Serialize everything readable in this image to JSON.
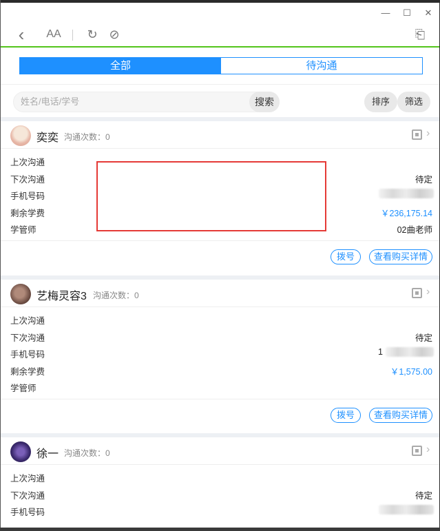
{
  "window": {
    "minimize": "—",
    "maximize": "☐",
    "close": "✕"
  },
  "toolbar": {
    "back_icon": "‹",
    "font_icon": "AA",
    "refresh_icon": "↻",
    "compass_icon": "⊘",
    "exit_icon": "⎗"
  },
  "tabs": [
    {
      "label": "全部",
      "active": true
    },
    {
      "label": "待沟通",
      "active": false
    }
  ],
  "search": {
    "placeholder": "姓名/电话/学号",
    "button": "搜索",
    "sort": "排序",
    "filter": "筛选"
  },
  "colors": {
    "accent": "#1e90ff",
    "progress": "#52c41a",
    "highlight_box": "#e53935"
  },
  "cards": [
    {
      "name": "奕奕",
      "count_label": "沟通次数：0",
      "rows": [
        {
          "label": "上次沟通",
          "value": ""
        },
        {
          "label": "下次沟通",
          "value": "待定"
        },
        {
          "label": "手机号码",
          "value": ""
        },
        {
          "label": "剩余学费",
          "value": "￥236,175.14"
        },
        {
          "label": "学管师",
          "value": "02曲老师"
        }
      ],
      "dial": "拨号",
      "details": "查看购买详情"
    },
    {
      "name": "艺梅灵容3",
      "count_label": "沟通次数：0",
      "rows": [
        {
          "label": "上次沟通",
          "value": ""
        },
        {
          "label": "下次沟通",
          "value": "待定"
        },
        {
          "label": "手机号码",
          "value": "1"
        },
        {
          "label": "剩余学费",
          "value": "￥1,575.00"
        },
        {
          "label": "学管师",
          "value": ""
        }
      ],
      "dial": "拨号",
      "details": "查看购买详情"
    },
    {
      "name": "徐一",
      "count_label": "沟通次数：0",
      "rows": [
        {
          "label": "上次沟通",
          "value": ""
        },
        {
          "label": "下次沟通",
          "value": "待定"
        },
        {
          "label": "手机号码",
          "value": ""
        }
      ]
    }
  ]
}
